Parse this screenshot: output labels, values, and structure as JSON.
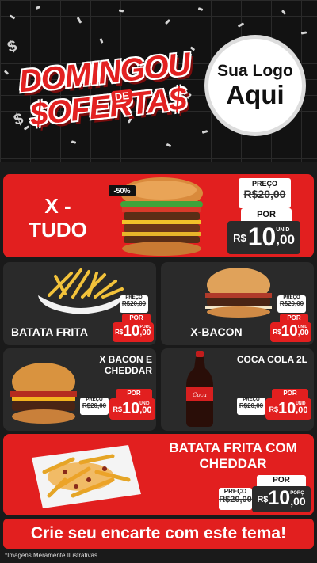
{
  "header": {
    "title_line1": "DOMINGOU",
    "title_de": "DE",
    "title_line2": "$OFERTA$",
    "logo_line1": "Sua Logo",
    "logo_line2": "Aqui"
  },
  "currency": "R$",
  "featured": {
    "name": "X - TUDO",
    "discount_badge": "-50%",
    "preco_label": "PREÇO",
    "old_price": "R$20,00",
    "por_label": "POR",
    "price_int": "10",
    "price_dec": ",00",
    "unit": "UNID"
  },
  "products": [
    {
      "name": "BATATA FRITA",
      "preco_label": "PREÇO",
      "old_price": "R$20,00",
      "por_label": "POR",
      "price_int": "10",
      "price_dec": ",00",
      "unit": "PORÇ"
    },
    {
      "name": "X-BACON",
      "preco_label": "PREÇO",
      "old_price": "R$20,00",
      "por_label": "POR",
      "price_int": "10",
      "price_dec": ",00",
      "unit": "UNID"
    },
    {
      "name": "X BACON E CHEDDAR",
      "preco_label": "PREÇO",
      "old_price": "R$20,00",
      "por_label": "POR",
      "price_int": "10",
      "price_dec": ",00",
      "unit": "UNID"
    },
    {
      "name": "COCA COLA 2L",
      "preco_label": "PREÇO",
      "old_price": "R$20,00",
      "por_label": "POR",
      "price_int": "10",
      "price_dec": ",00",
      "unit": "UNID"
    }
  ],
  "bottom_item": {
    "name": "BATATA FRITA COM CHEDDAR",
    "preco_label": "PREÇO",
    "old_price": "R$20,00",
    "por_label": "POR",
    "price_int": "10",
    "price_dec": ",00",
    "unit": "PORÇ"
  },
  "footer_text": "Crie seu encarte com este tema!",
  "disclaimer": "*Imagens Meramente Ilustrativas",
  "colors": {
    "accent": "#e21f1f",
    "dark": "#2a2a2a",
    "background": "#121212"
  }
}
